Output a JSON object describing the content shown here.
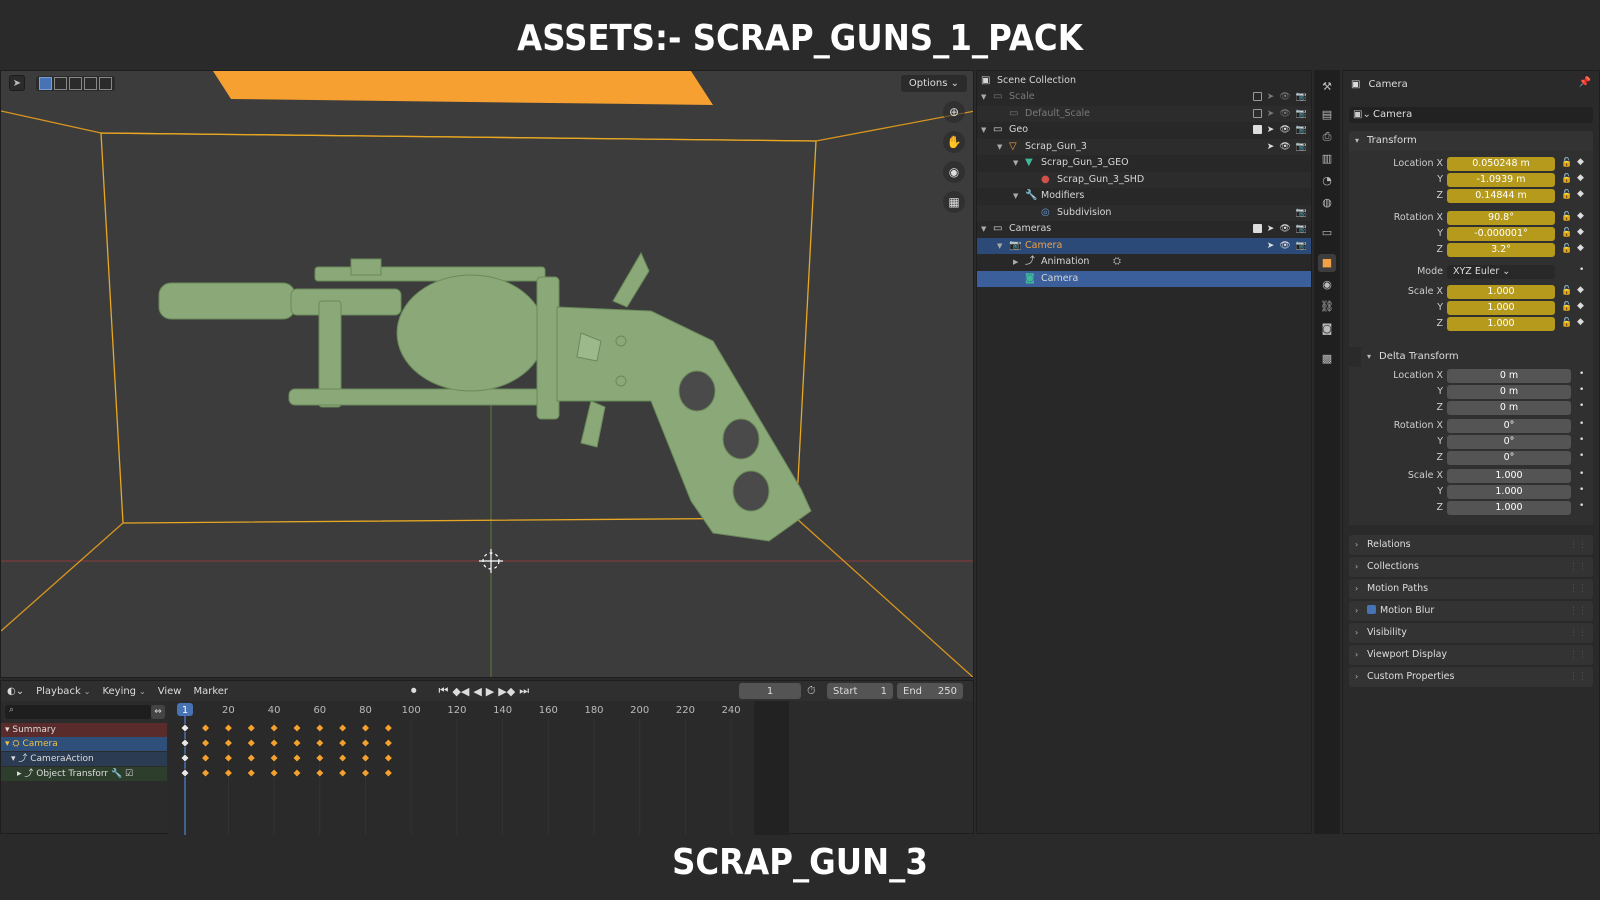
{
  "banner": {
    "top": "ASSETS:- SCRAP_GUNS_1_PACK",
    "bottom": "SCRAP_GUN_3"
  },
  "viewport": {
    "options_label": "Options"
  },
  "timeline": {
    "menus": [
      "Playback",
      "Keying",
      "View",
      "Marker"
    ],
    "current_frame": "1",
    "start_label": "Start",
    "start_value": "1",
    "end_label": "End",
    "end_value": "250",
    "ruler": [
      "1",
      "20",
      "40",
      "60",
      "80",
      "100",
      "120",
      "140",
      "160",
      "180",
      "200",
      "220",
      "240"
    ],
    "channels": {
      "summary": "Summary",
      "camera": "Camera",
      "action": "CameraAction",
      "transform": "Object Transforr"
    }
  },
  "outliner": {
    "root": "Scene Collection",
    "items": [
      {
        "label": "Scale",
        "depth": 0,
        "icon": "collection-icon",
        "state": "dim"
      },
      {
        "label": "Default_Scale",
        "depth": 1,
        "icon": "collection-icon",
        "state": "dim"
      },
      {
        "label": "Geo",
        "depth": 0,
        "icon": "collection-icon",
        "state": "normal"
      },
      {
        "label": "Scrap_Gun_3",
        "depth": 1,
        "icon": "object-icon",
        "state": "normal"
      },
      {
        "label": "Scrap_Gun_3_GEO",
        "depth": 2,
        "icon": "mesh-icon",
        "state": "normal"
      },
      {
        "label": "Scrap_Gun_3_SHD",
        "depth": 3,
        "icon": "material-icon",
        "state": "normal"
      },
      {
        "label": "Modifiers",
        "depth": 2,
        "icon": "wrench-icon",
        "state": "normal"
      },
      {
        "label": "Subdivision",
        "depth": 3,
        "icon": "modifier-icon",
        "state": "normal"
      },
      {
        "label": "Cameras",
        "depth": 0,
        "icon": "collection-icon",
        "state": "normal"
      },
      {
        "label": "Camera",
        "depth": 1,
        "icon": "camera-icon",
        "state": "selected"
      },
      {
        "label": "Animation",
        "depth": 2,
        "icon": "animation-icon",
        "state": "normal"
      },
      {
        "label": "Camera",
        "depth": 2,
        "icon": "camera-data-icon",
        "state": "active"
      }
    ]
  },
  "properties": {
    "header": "Camera",
    "object_name": "Camera",
    "transform": {
      "title": "Transform",
      "location": {
        "label": "Location X",
        "x": "0.050248 m",
        "y": "-1.0939 m",
        "z": "0.14844 m"
      },
      "rotation": {
        "label": "Rotation X",
        "x": "90.8°",
        "y": "-0.000001°",
        "z": "3.2°"
      },
      "mode_label": "Mode",
      "mode_value": "XYZ Euler",
      "scale": {
        "label": "Scale X",
        "x": "1.000",
        "y": "1.000",
        "z": "1.000"
      },
      "axis_y": "Y",
      "axis_z": "Z"
    },
    "delta": {
      "title": "Delta Transform",
      "location": {
        "label": "Location X",
        "x": "0 m",
        "y": "0 m",
        "z": "0 m"
      },
      "rotation": {
        "label": "Rotation X",
        "x": "0°",
        "y": "0°",
        "z": "0°"
      },
      "scale": {
        "label": "Scale X",
        "x": "1.000",
        "y": "1.000",
        "z": "1.000"
      }
    },
    "collapsed": [
      "Relations",
      "Collections",
      "Motion Paths",
      "Motion Blur",
      "Visibility",
      "Viewport Display",
      "Custom Properties"
    ]
  },
  "colors": {
    "keyframed": "#b59a1c",
    "selected": "#2b4a78",
    "accent": "#f2a046",
    "model": "#8aa878"
  }
}
